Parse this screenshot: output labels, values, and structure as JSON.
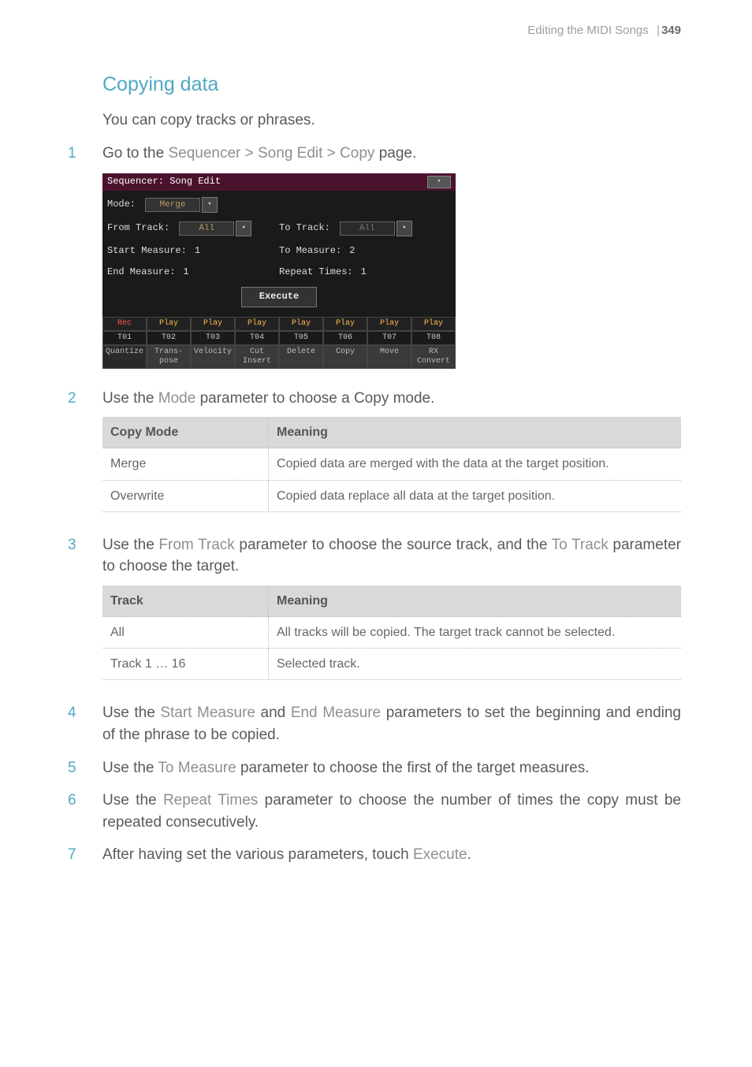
{
  "header": {
    "section": "Editing the MIDI Songs",
    "separator": "|",
    "page_number": "349"
  },
  "title": "Copying data",
  "intro": "You can copy tracks or phrases.",
  "steps": {
    "s1_a": "Go to the ",
    "s1_b": "Sequencer > Song Edit > Copy",
    "s1_c": " page.",
    "s2_a": "Use the ",
    "s2_b": "Mode",
    "s2_c": " parameter to choose a Copy mode.",
    "s3_a": "Use the ",
    "s3_b": "From Track",
    "s3_c": " parameter to choose the source track, and the ",
    "s3_d": "To Track",
    "s3_e": " parameter to choose the target.",
    "s4_a": "Use the ",
    "s4_b": "Start Measure",
    "s4_c": " and ",
    "s4_d": "End Measure",
    "s4_e": " parameters to set the beginning and ending of the phrase to be copied.",
    "s5_a": "Use the ",
    "s5_b": "To Measure",
    "s5_c": " parameter to choose the first of the target measures.",
    "s6_a": "Use the ",
    "s6_b": "Repeat Times",
    "s6_c": " parameter to choose the number of times the copy must be repeated consecutively.",
    "s7_a": "After having set the various parameters, touch ",
    "s7_b": "Execute",
    "s7_c": "."
  },
  "screenshot": {
    "title": "Sequencer: Song Edit",
    "mode_label": "Mode:",
    "mode_value": "Merge",
    "from_track_label": "From Track:",
    "from_track_value": "All",
    "to_track_label": "To Track:",
    "to_track_value": "All",
    "start_measure_label": "Start Measure:",
    "start_measure_value": "1",
    "to_measure_label": "To Measure:",
    "to_measure_value": "2",
    "end_measure_label": "End Measure:",
    "end_measure_value": "1",
    "repeat_times_label": "Repeat Times:",
    "repeat_times_value": "1",
    "execute": "Execute",
    "tracks_status": [
      "Rec",
      "Play",
      "Play",
      "Play",
      "Play",
      "Play",
      "Play",
      "Play"
    ],
    "tracks_id": [
      "T01",
      "T02",
      "T03",
      "T04",
      "T05",
      "T06",
      "T07",
      "T08"
    ],
    "tabs": [
      "Quantize",
      "Trans-\npose",
      "Velocity",
      "Cut\nInsert",
      "Delete",
      "Copy",
      "Move",
      "RX\nConvert"
    ]
  },
  "table_mode": {
    "h1": "Copy Mode",
    "h2": "Meaning",
    "rows": [
      {
        "c1": "Merge",
        "c2": "Copied data are merged with the data at the target position."
      },
      {
        "c1": "Overwrite",
        "c2": "Copied data replace all data at the target position."
      }
    ]
  },
  "table_track": {
    "h1": "Track",
    "h2": "Meaning",
    "rows": [
      {
        "c1": "All",
        "c2": "All tracks will be copied. The target track cannot be selected."
      },
      {
        "c1": "Track 1 … 16",
        "c2": "Selected track."
      }
    ]
  }
}
